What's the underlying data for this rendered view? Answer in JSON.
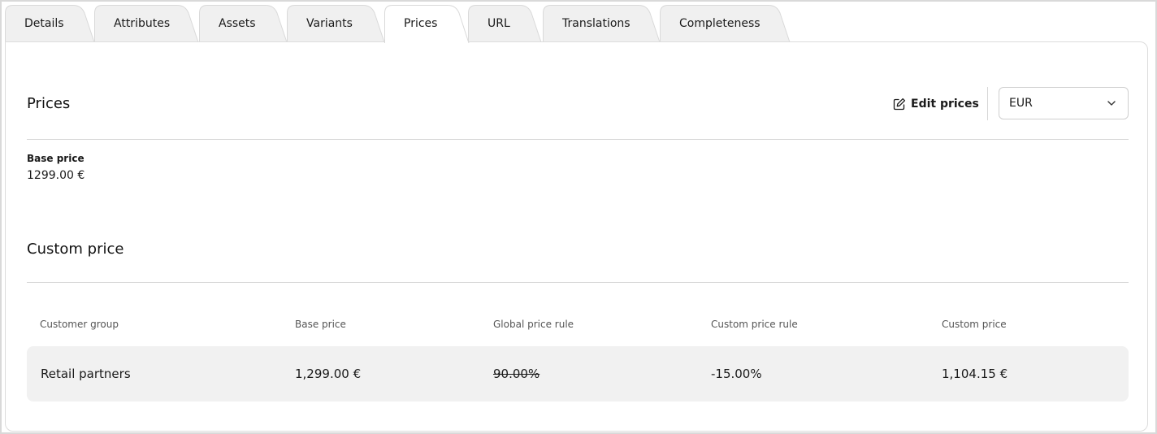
{
  "tabs": [
    {
      "label": "Details",
      "active": false
    },
    {
      "label": "Attributes",
      "active": false
    },
    {
      "label": "Assets",
      "active": false
    },
    {
      "label": "Variants",
      "active": false
    },
    {
      "label": "Prices",
      "active": true
    },
    {
      "label": "URL",
      "active": false
    },
    {
      "label": "Translations",
      "active": false
    },
    {
      "label": "Completeness",
      "active": false
    }
  ],
  "prices": {
    "title": "Prices",
    "edit_label": "Edit prices",
    "edit_icon": "pencil-square-icon",
    "currency": "EUR",
    "base_price_label": "Base price",
    "base_price_value": "1299.00 €"
  },
  "custom_price": {
    "title": "Custom price",
    "columns": [
      "Customer group",
      "Base price",
      "Global price rule",
      "Custom price rule",
      "Custom price"
    ],
    "rows": [
      {
        "customer_group": "Retail partners",
        "base_price": "1,299.00 €",
        "global_price_rule": "90.00%",
        "global_price_rule_struck": true,
        "custom_price_rule": "-15.00%",
        "custom_price": "1,104.15 €"
      }
    ]
  },
  "colors": {
    "tab_inactive": "#f0f0f0",
    "tab_border": "#d9d9d9",
    "row_background": "#f1f1f1"
  }
}
